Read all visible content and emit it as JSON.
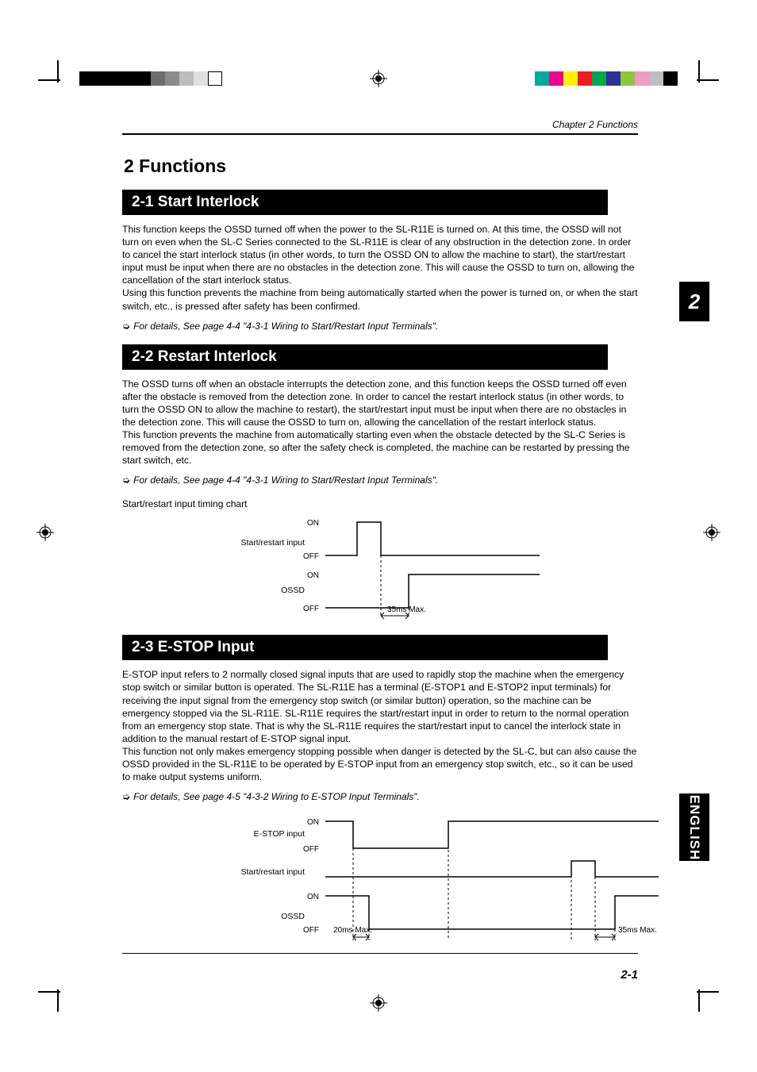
{
  "header": {
    "chapter": "Chapter 2  Functions"
  },
  "chapter_title": "2 Functions",
  "sections": {
    "s1": {
      "title": "2-1  Start Interlock",
      "body": "This function keeps the OSSD turned off when the power to the SL-R11E is turned on. At this time, the OSSD will not turn on even when the SL-C Series connected to the SL-R11E is clear of any obstruction in the detection zone. In order to cancel the start interlock status (in other words, to turn the OSSD ON to allow the machine to start), the start/restart input must be input when there are no obstacles in the detection zone. This will cause the OSSD to turn on, allowing the cancellation of the start interlock status.\nUsing this function prevents the machine from being automatically started when the power is turned on, or when the start switch, etc., is pressed after safety has been confirmed.",
      "ref": "For details, See page 4-4 \"4-3-1 Wiring to Start/Restart Input Terminals\"."
    },
    "s2": {
      "title": "2-2  Restart Interlock",
      "body": "The OSSD turns off when an obstacle interrupts the detection zone, and this function keeps the OSSD turned off even after the obstacle is removed from the detection zone. In order to cancel the restart interlock status (in other words, to turn the OSSD ON to allow the machine to restart), the start/restart input must be input when there are no obstacles in the detection zone. This will cause the OSSD to turn on, allowing the cancellation of the restart interlock status.\nThis function prevents the machine from automatically starting even when the obstacle detected by the SL-C Series is removed from the detection zone, so after the safety check is completed, the machine can be restarted by pressing the start switch, etc.",
      "ref": "For details, See page 4-4 \"4-3-1 Wiring to Start/Restart Input Terminals\".",
      "chart_caption": "Start/restart input timing chart"
    },
    "s3": {
      "title": "2-3  E-STOP Input",
      "body": "E-STOP input refers to 2 normally closed signal inputs that are used to rapidly stop the machine when the emergency stop switch or similar button is operated. The SL-R11E has a terminal (E-STOP1 and E-STOP2 input terminals) for receiving the input signal from the emergency stop switch (or similar button) operation, so the machine can be emergency stopped via the SL-R11E. SL-R11E requires the start/restart input in order to return to the normal operation from an emergency stop state. That is why the SL-R11E requires the start/restart input to cancel the interlock state in addition to the manual restart of E-STOP signal input.\nThis function not only makes emergency stopping possible when danger is detected by the SL-C, but can also cause the OSSD provided in the SL-R11E to be operated by E-STOP input from an emergency stop switch, etc., so it can be used to make output systems uniform.",
      "ref": "For details, See page 4-5 \"4-3-2 Wiring to E-STOP Input Terminals\"."
    }
  },
  "tab_number": "2",
  "lang": "ENGLISH",
  "page_number": "2-1",
  "chart_data": [
    {
      "type": "timing",
      "title": "Start/restart input timing chart",
      "signals": [
        {
          "name": "Start/restart input",
          "levels": [
            "ON",
            "OFF"
          ],
          "sequence": [
            {
              "level": "OFF",
              "t": 0
            },
            {
              "level": "ON",
              "t": 1
            },
            {
              "level": "OFF",
              "t": 2
            }
          ]
        },
        {
          "name": "OSSD",
          "levels": [
            "ON",
            "OFF"
          ],
          "sequence": [
            {
              "level": "OFF",
              "t": 0
            },
            {
              "level": "ON",
              "t": 2.3
            }
          ]
        }
      ],
      "annotations": [
        {
          "text": "35ms Max.",
          "between": [
            "Start/restart input fall",
            "OSSD rise"
          ]
        }
      ]
    },
    {
      "type": "timing",
      "title": "E-STOP input timing chart",
      "signals": [
        {
          "name": "E-STOP input",
          "levels": [
            "ON",
            "OFF"
          ],
          "sequence": [
            {
              "level": "ON",
              "t": 0
            },
            {
              "level": "OFF",
              "t": 1
            },
            {
              "level": "ON",
              "t": 3
            }
          ]
        },
        {
          "name": "Start/restart input",
          "levels": [
            ""
          ],
          "sequence": [
            {
              "level": "LOW",
              "t": 0
            },
            {
              "level": "HIGH",
              "t": 5
            },
            {
              "level": "LOW",
              "t": 5.5
            }
          ]
        },
        {
          "name": "OSSD",
          "levels": [
            "ON",
            "OFF"
          ],
          "sequence": [
            {
              "level": "ON",
              "t": 0
            },
            {
              "level": "OFF",
              "t": 1.2
            },
            {
              "level": "ON",
              "t": 5.8
            }
          ]
        }
      ],
      "annotations": [
        {
          "text": "20ms Max.",
          "between": [
            "E-STOP fall",
            "OSSD fall"
          ]
        },
        {
          "text": "35ms Max.",
          "between": [
            "Start/restart fall",
            "OSSD rise"
          ]
        }
      ]
    }
  ],
  "timing_labels": {
    "start_restart": "Start/restart input",
    "ossd": "OSSD",
    "estop": "E-STOP input",
    "on": "ON",
    "off": "OFF",
    "t35": "35ms Max.",
    "t20": "20ms Max."
  },
  "swatches_left": [
    "#000",
    "#000",
    "#000",
    "#000",
    "#000",
    "#7d7d7d",
    "#808080",
    "#b0b0b0",
    "#d9d9d9",
    "#f0f0f0"
  ],
  "swatches_right": [
    "#00a0a0",
    "#d00080",
    "#e0e000",
    "#d00000",
    "#00a000",
    "#0000c0",
    "#60c060",
    "#e080c0",
    "#c0c0c0",
    "#000"
  ]
}
